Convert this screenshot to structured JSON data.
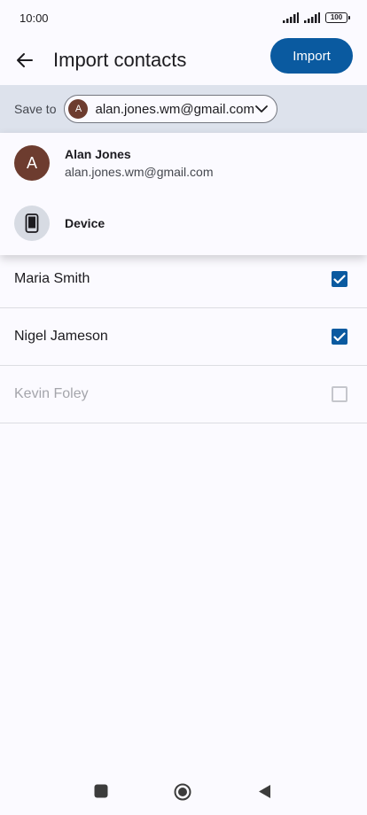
{
  "status_bar": {
    "time": "10:00",
    "battery": "100"
  },
  "app_bar": {
    "title": "Import contacts",
    "import_label": "Import",
    "back_icon": "arrow-back-icon"
  },
  "save_to": {
    "label": "Save to",
    "selected_account": {
      "initial": "A",
      "email": "alan.jones.wm@gmail.com"
    }
  },
  "dropdown": {
    "items": [
      {
        "initial": "A",
        "name": "Alan Jones",
        "email": "alan.jones.wm@gmail.com"
      },
      {
        "icon": "phone-device-icon",
        "name": "Device"
      }
    ]
  },
  "contacts": [
    {
      "name": "Maria Smith",
      "checked": true,
      "enabled": true
    },
    {
      "name": "Nigel Jameson",
      "checked": true,
      "enabled": true
    },
    {
      "name": "Kevin Foley",
      "checked": false,
      "enabled": false
    }
  ],
  "colors": {
    "primary": "#0a5aa0",
    "avatar": "#6d3c2f",
    "save_bar": "#dde2ec",
    "background": "#fbfaff"
  }
}
